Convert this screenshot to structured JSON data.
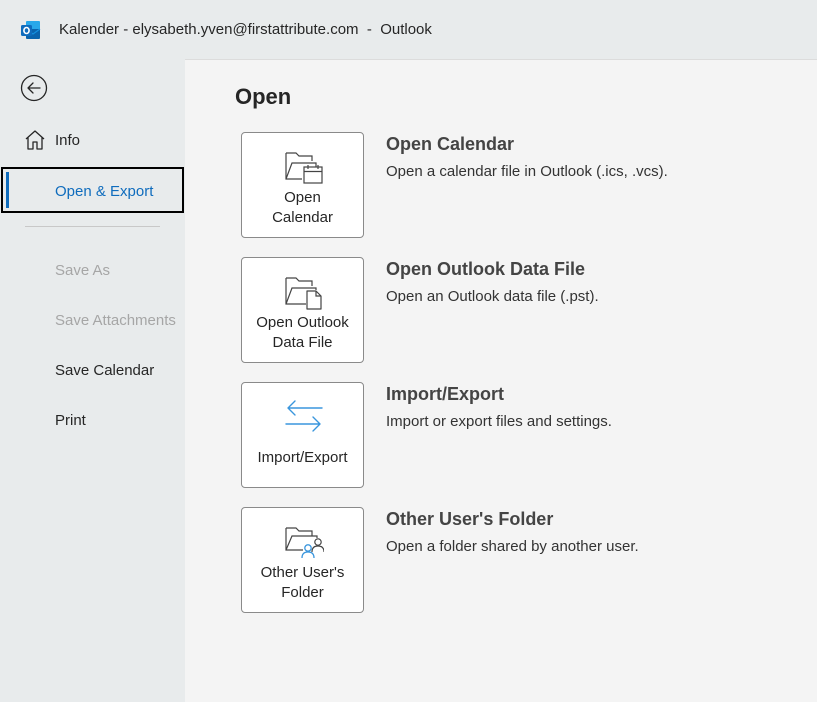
{
  "window": {
    "title": "Kalender - elysabeth.yven@firstattribute.com  -  Outlook",
    "app_icon": "outlook-logo-icon"
  },
  "sidebar": {
    "back_icon": "back-arrow-circle-icon",
    "items": [
      {
        "label": "Info",
        "icon": "home-icon",
        "state": "normal"
      },
      {
        "label": "Open & Export",
        "state": "selected"
      },
      {
        "label": "Save As",
        "state": "disabled"
      },
      {
        "label": "Save Attachments",
        "state": "disabled"
      },
      {
        "label": "Save Calendar",
        "state": "normal"
      },
      {
        "label": "Print",
        "state": "normal"
      }
    ]
  },
  "main": {
    "section_title": "Open",
    "options": [
      {
        "tile_label_line1": "Open",
        "tile_label_line2": "Calendar",
        "icon": "folder-calendar-icon",
        "heading": "Open Calendar",
        "description": "Open a calendar file in Outlook (.ics, .vcs)."
      },
      {
        "tile_label_line1": "Open Outlook",
        "tile_label_line2": "Data File",
        "icon": "folder-file-icon",
        "heading": "Open Outlook Data File",
        "description": "Open an Outlook data file (.pst)."
      },
      {
        "tile_label_line1": "Import/Export",
        "icon": "import-export-arrows-icon",
        "heading": "Import/Export",
        "description": "Import or export files and settings."
      },
      {
        "tile_label_line1": "Other User's",
        "tile_label_line2": "Folder",
        "icon": "folder-shared-users-icon",
        "heading": "Other User's Folder",
        "description": "Open a folder shared by another user."
      }
    ]
  },
  "colors": {
    "accent": "#0f6cbd",
    "chrome_background": "#e8ebec",
    "content_background": "#f4f4f4",
    "disabled_text": "#a6a6a6"
  }
}
